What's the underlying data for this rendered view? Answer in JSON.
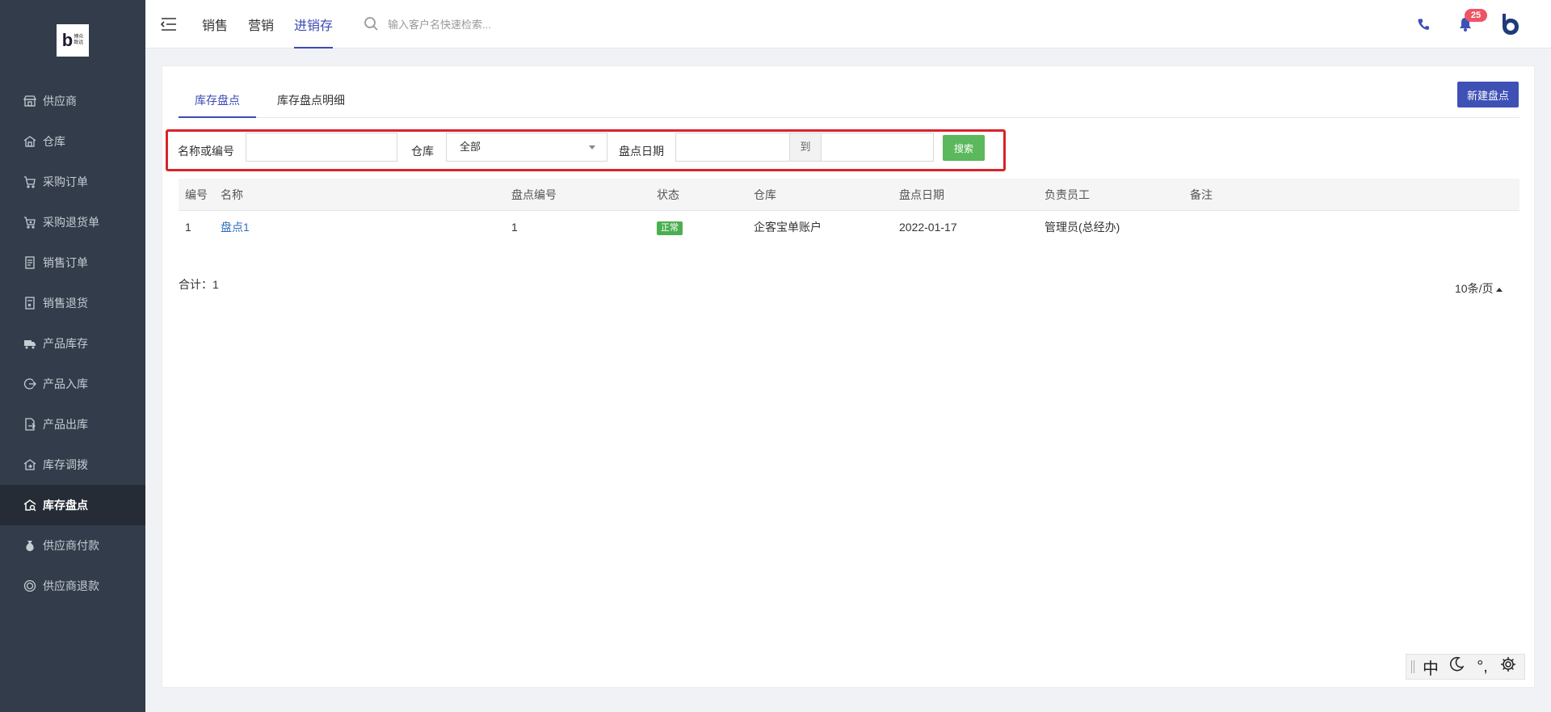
{
  "sidebar": {
    "logo_text": [
      "博众",
      "致远"
    ],
    "items": [
      {
        "label": "供应商",
        "icon": "store-icon"
      },
      {
        "label": "仓库",
        "icon": "warehouse-icon"
      },
      {
        "label": "采购订单",
        "icon": "cart-icon"
      },
      {
        "label": "采购退货单",
        "icon": "cart-return-icon"
      },
      {
        "label": "销售订单",
        "icon": "document-icon"
      },
      {
        "label": "销售退货",
        "icon": "document-return-icon"
      },
      {
        "label": "产品库存",
        "icon": "truck-icon"
      },
      {
        "label": "产品入库",
        "icon": "stock-in-icon"
      },
      {
        "label": "产品出库",
        "icon": "stock-out-icon"
      },
      {
        "label": "库存调拨",
        "icon": "transfer-icon"
      },
      {
        "label": "库存盘点",
        "icon": "inventory-check-icon",
        "active": true
      },
      {
        "label": "供应商付款",
        "icon": "money-bag-icon"
      },
      {
        "label": "供应商退款",
        "icon": "refund-icon"
      }
    ]
  },
  "header": {
    "tabs": [
      {
        "label": "销售"
      },
      {
        "label": "营销"
      },
      {
        "label": "进销存",
        "active": true
      }
    ],
    "search_placeholder": "输入客户名快速检索...",
    "notification_count": "25",
    "accent": "#3b4bb5"
  },
  "main": {
    "tabs": [
      {
        "label": "库存盘点",
        "active": true
      },
      {
        "label": "库存盘点明细"
      }
    ],
    "new_button": "新建盘点",
    "filter": {
      "name_label": "名称或编号",
      "name_value": "",
      "warehouse_label": "仓库",
      "warehouse_value": "全部",
      "date_label": "盘点日期",
      "date_from": "",
      "to_label": "到",
      "date_to": "",
      "search_button": "搜索"
    },
    "table": {
      "columns": [
        "编号",
        "名称",
        "盘点编号",
        "状态",
        "仓库",
        "盘点日期",
        "负责员工",
        "备注"
      ],
      "rows": [
        {
          "id": "1",
          "name": "盘点1",
          "code": "1",
          "status": "正常",
          "warehouse": "企客宝单账户",
          "date": "2022-01-17",
          "staff": "管理员(总经办)",
          "remark": ""
        }
      ]
    },
    "total_label": "合计：1",
    "page_size": "10条/页"
  },
  "ime": {
    "lang": "中",
    "punct": "°,"
  },
  "colors": {
    "sidebar_bg": "#323c4a",
    "primary": "#3f51b5",
    "success": "#5cb85c",
    "highlight_border": "#d9232a",
    "badge": "#ed5565"
  }
}
